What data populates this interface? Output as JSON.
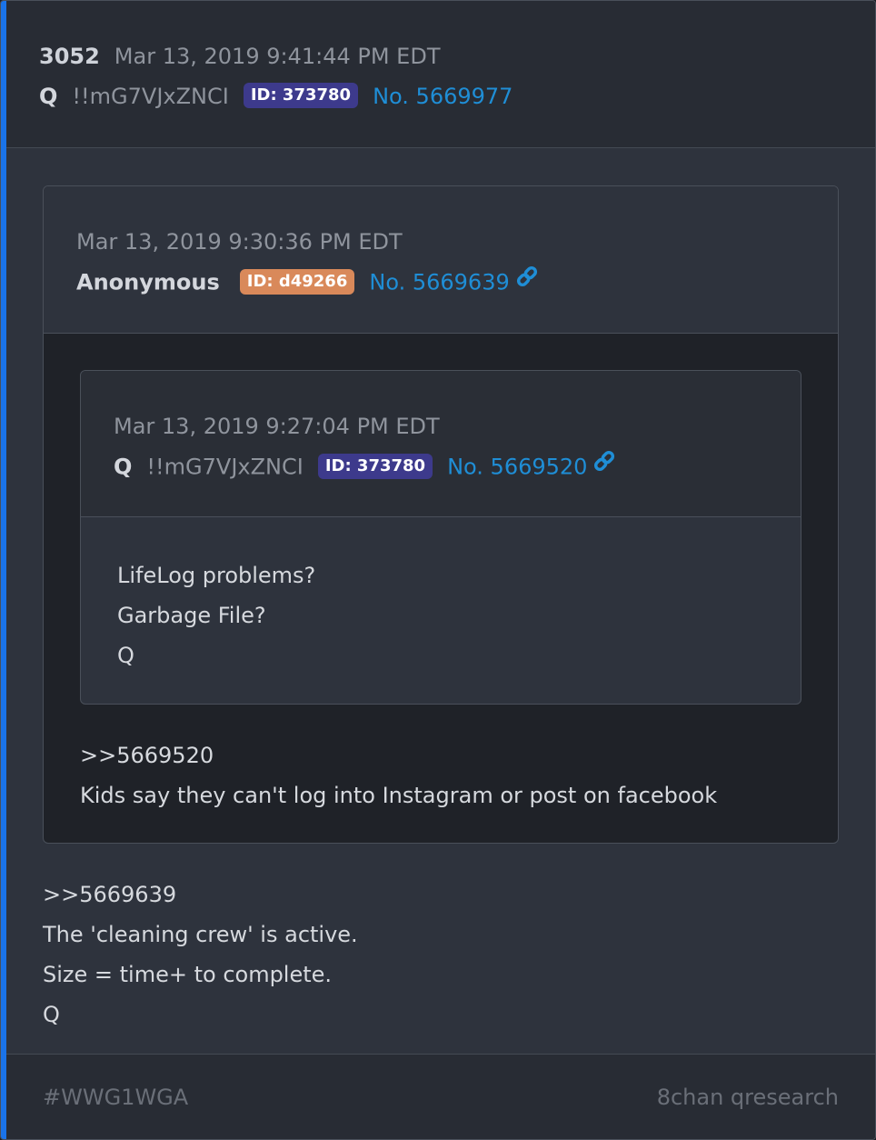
{
  "post": {
    "number": "3052",
    "date": "Mar 13, 2019 9:41:44 PM EDT",
    "author": "Q",
    "tripcode": "!!mG7VJxZNCI",
    "id_badge": "ID: 373780",
    "post_no": "No. 5669977",
    "body": [
      ">>5669639",
      "The 'cleaning crew' is active.",
      "Size = time+ to complete.",
      "Q"
    ]
  },
  "quote1": {
    "date": "Mar 13, 2019 9:30:36 PM EDT",
    "author": "Anonymous",
    "id_badge": "ID: d49266",
    "post_no": "No. 5669639",
    "link_icon": "chain-link-icon",
    "body": [
      ">>5669520",
      "Kids say they can't log into Instagram or post on facebook"
    ]
  },
  "quote2": {
    "date": "Mar 13, 2019 9:27:04 PM EDT",
    "author": "Q",
    "tripcode": "!!mG7VJxZNCI",
    "id_badge": "ID: 373780",
    "post_no": "No. 5669520",
    "link_icon": "chain-link-icon",
    "body": [
      "LifeLog problems?",
      "Garbage File?",
      "Q"
    ]
  },
  "footer": {
    "hashtag": "#WWG1WGA",
    "source": "8chan qresearch"
  },
  "colors": {
    "accent": "#1a73e8",
    "link": "#1f8ed6",
    "badge_q": "#3d3a8c",
    "badge_anon": "#d9895a"
  }
}
